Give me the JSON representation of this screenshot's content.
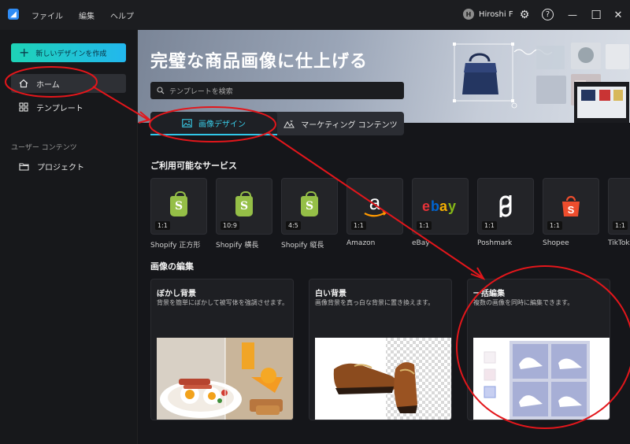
{
  "titlebar": {
    "menu": [
      "ファイル",
      "編集",
      "ヘルプ"
    ],
    "user_initial": "H",
    "user_name": "Hiroshi F",
    "settings_glyph": "⚙",
    "help_glyph": "?",
    "minimize_glyph": "—",
    "maximize_glyph": "☐",
    "close_glyph": "✕"
  },
  "sidebar": {
    "new_design_label": "新しいデザインを作成",
    "items": [
      {
        "label": "ホーム",
        "icon": "home-icon",
        "active": true
      },
      {
        "label": "テンプレート",
        "icon": "grid-icon",
        "active": false
      }
    ],
    "section_label": "ユーザー コンテンツ",
    "project_label": "プロジェクト"
  },
  "hero": {
    "title": "完璧な商品画像に仕上げる",
    "search_placeholder": "テンプレートを検索",
    "tabs": [
      {
        "label": "画像デザイン",
        "active": true
      },
      {
        "label": "マーケティング コンテンツ",
        "active": false
      }
    ]
  },
  "services": {
    "title": "ご利用可能なサービス",
    "items": [
      {
        "name": "Shopify 正方形",
        "ratio": "1:1",
        "logo": "shopify"
      },
      {
        "name": "Shopify 横長",
        "ratio": "10:9",
        "logo": "shopify"
      },
      {
        "name": "Shopify 縦長",
        "ratio": "4:5",
        "logo": "shopify"
      },
      {
        "name": "Amazon",
        "ratio": "1:1",
        "logo": "amazon"
      },
      {
        "name": "eBay",
        "ratio": "1:1",
        "logo": "ebay"
      },
      {
        "name": "Poshmark",
        "ratio": "1:1",
        "logo": "poshmark"
      },
      {
        "name": "Shopee",
        "ratio": "1:1",
        "logo": "shopee"
      },
      {
        "name": "TikTok",
        "ratio": "1:1",
        "logo": "tiktok"
      }
    ]
  },
  "editing": {
    "title": "画像の編集",
    "cards": [
      {
        "title": "ぼかし背景",
        "desc": "背景を簡単にぼかして被写体を強調させます。"
      },
      {
        "title": "白い背景",
        "desc": "画像背景を真っ白な背景に置き換えます。"
      },
      {
        "title": "一括編集",
        "desc": "複数の画像を同時に編集できます。"
      }
    ]
  },
  "colors": {
    "accent": "#31c7e9",
    "annotation": "#e3161b",
    "shopify": "#95bf47"
  }
}
